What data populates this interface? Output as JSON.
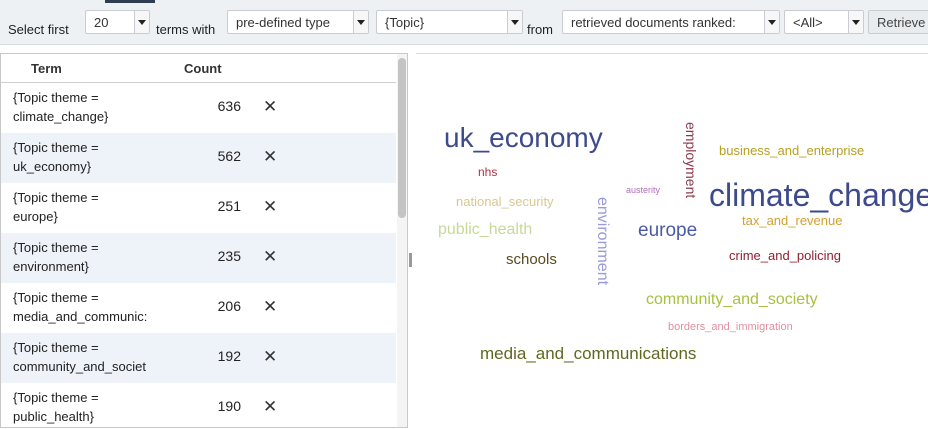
{
  "toolbar": {
    "select_label": "Select first",
    "count_value": "20",
    "terms_with_label": "terms with",
    "type_value": "pre-defined type",
    "topic_value": "{Topic}",
    "from_label": "from",
    "source_value": "retrieved documents ranked:",
    "rank_value": "<All>",
    "retrieve_label": "Retrieve"
  },
  "table": {
    "col_term": "Term",
    "col_count": "Count",
    "delete_icon": "close-icon",
    "rows": [
      {
        "term_line1": "{Topic theme =",
        "term_line2": "climate_change}",
        "count": "636",
        "del": "✕"
      },
      {
        "term_line1": "{Topic theme =",
        "term_line2": "uk_economy}",
        "count": "562",
        "del": "✕"
      },
      {
        "term_line1": "{Topic theme =",
        "term_line2": "europe}",
        "count": "251",
        "del": "✕"
      },
      {
        "term_line1": "{Topic theme =",
        "term_line2": "environment}",
        "count": "235",
        "del": "✕"
      },
      {
        "term_line1": "{Topic theme =",
        "term_line2": "media_and_communic:",
        "count": "206",
        "del": "✕"
      },
      {
        "term_line1": "{Topic theme =",
        "term_line2": "community_and_societ",
        "count": "192",
        "del": "✕"
      },
      {
        "term_line1": "{Topic theme =",
        "term_line2": "public_health}",
        "count": "190",
        "del": "✕"
      }
    ]
  },
  "cloud": {
    "words": [
      {
        "text": "uk_economy",
        "color": "#3d4a8c"
      },
      {
        "text": "employment",
        "color": "#8b3a4a"
      },
      {
        "text": "business_and_enterprise",
        "color": "#b8a020"
      },
      {
        "text": "nhs",
        "color": "#b03040"
      },
      {
        "text": "austerity",
        "color": "#b070c0"
      },
      {
        "text": "climate_change",
        "color": "#3d4a8c"
      },
      {
        "text": "national_security",
        "color": "#d8c890"
      },
      {
        "text": "environment",
        "color": "#9a9ad8"
      },
      {
        "text": "europe",
        "color": "#4a5aa8"
      },
      {
        "text": "tax_and_revenue",
        "color": "#d0a030"
      },
      {
        "text": "public_health",
        "color": "#c8d898"
      },
      {
        "text": "schools",
        "color": "#5a4a20"
      },
      {
        "text": "crime_and_policing",
        "color": "#902030"
      },
      {
        "text": "community_and_society",
        "color": "#a8c040"
      },
      {
        "text": "borders_and_immigration",
        "color": "#e090a0"
      },
      {
        "text": "media_and_communications",
        "color": "#606820"
      }
    ]
  }
}
